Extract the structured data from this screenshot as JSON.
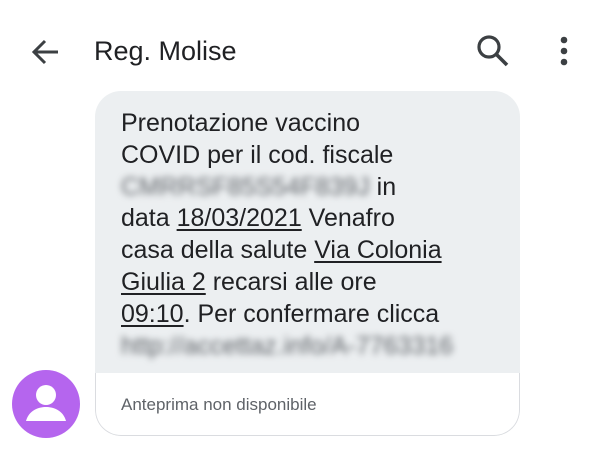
{
  "header": {
    "title": "Reg. Molise",
    "back_icon": "arrow-back-icon",
    "search_icon": "search-icon",
    "more_icon": "more-vert-icon"
  },
  "message": {
    "line1": "Prenotazione vaccino",
    "line2": "COVID per il cod. fiscale",
    "fiscal_code_redacted": "CMRRSF85S54F839J",
    "line3_suffix": " in",
    "line4_prefix": "data ",
    "date": "18/03/2021",
    "line4_suffix": " Venafro",
    "line5_prefix": "casa della salute ",
    "address_part1": "Via Colonia",
    "address_part2": "Giulia 2",
    "line6_suffix": " recarsi alle ore",
    "time": "09:10",
    "line7_suffix": ". Per confermare clicca",
    "link_redacted": "http://accettaz.info/A-7763316"
  },
  "preview": {
    "label": "Anteprima non disponibile"
  },
  "colors": {
    "bubble_bg": "#eceff1",
    "avatar_bg": "#b565ee",
    "text": "#202124",
    "secondary_text": "#5f6368"
  }
}
